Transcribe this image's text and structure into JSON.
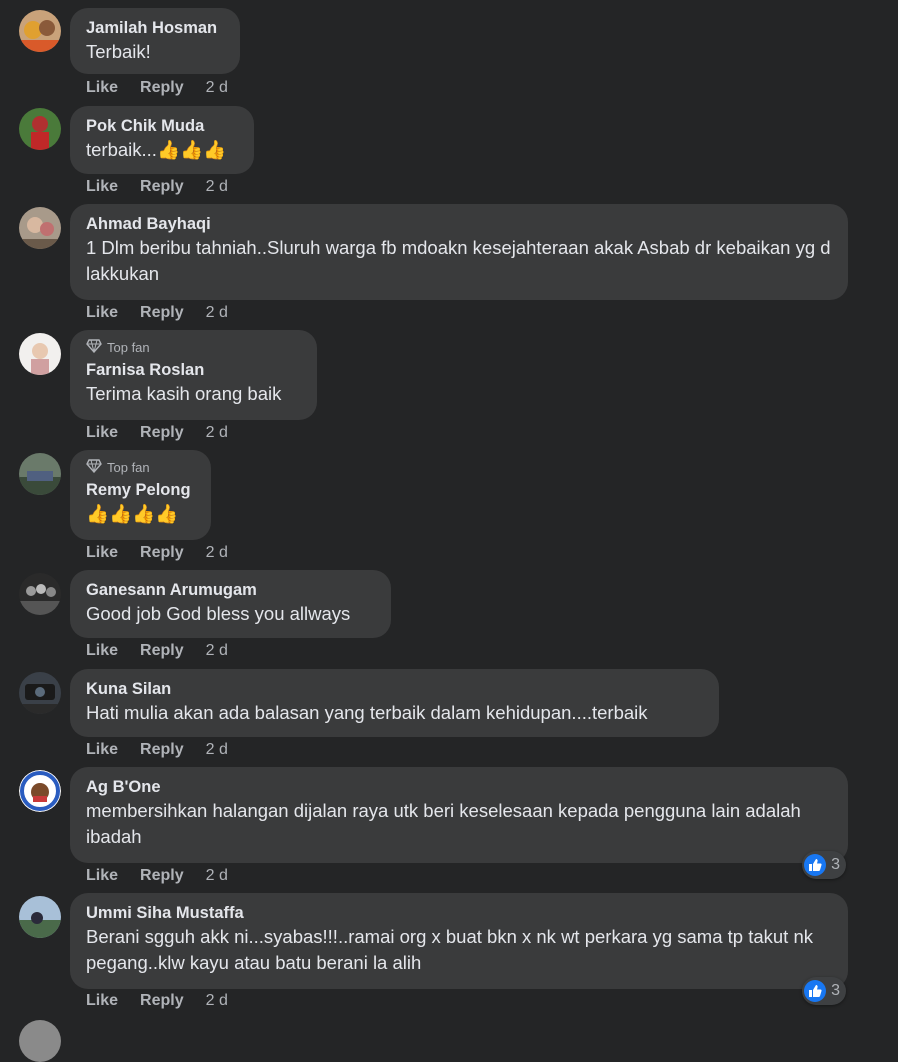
{
  "labels": {
    "like": "Like",
    "reply": "Reply"
  },
  "colors": {
    "background": "#242526",
    "bubble": "#3a3b3c",
    "text": "#e4e6eb",
    "secondary": "#b0b3b8",
    "like_blue": "#1877f2"
  },
  "comments": [
    {
      "author": "Jamilah Hosman",
      "text": "Terbaik!",
      "time": "2 d",
      "avatar": "avatar-jamilah"
    },
    {
      "author": "Pok Chik Muda",
      "text": "terbaik...👍👍👍",
      "time": "2 d",
      "avatar": "avatar-pokchik"
    },
    {
      "author": "Ahmad Bayhaqi",
      "text": "1 Dlm beribu tahniah..Sluruh warga fb mdoakn kesejahteraan akak Asbab dr kebaikan yg d lakkukan",
      "time": "2 d",
      "avatar": "avatar-ahmad"
    },
    {
      "author": "Farnisa Roslan",
      "badge": "Top fan",
      "text": "Terima kasih orang baik",
      "time": "2 d",
      "avatar": "avatar-farnisa"
    },
    {
      "author": "Remy Pelong",
      "badge": "Top fan",
      "text": "👍👍👍👍",
      "time": "2 d",
      "avatar": "avatar-remy"
    },
    {
      "author": "Ganesann Arumugam",
      "text": "Good job God bless you allways",
      "time": "2 d",
      "avatar": "avatar-ganesann"
    },
    {
      "author": "Kuna Silan",
      "text": "Hati mulia akan ada balasan yang terbaik dalam kehidupan....terbaik",
      "time": "2 d",
      "avatar": "avatar-kuna"
    },
    {
      "author": "Ag B'One",
      "text": "membersihkan halangan dijalan raya utk beri keselesaan kepada pengguna lain adalah ibadah",
      "time": "2 d",
      "reactions": "3",
      "reaction_icon": "like-icon",
      "avatar": "avatar-agbone"
    },
    {
      "author": "Ummi Siha Mustaffa",
      "text": "Berani sgguh akk ni...syabas!!!..ramai org x buat bkn x nk wt perkara yg sama tp takut nk pegang..klw kayu atau batu berani la alih",
      "time": "2 d",
      "reactions": "3",
      "reaction_icon": "like-icon",
      "avatar": "avatar-ummi"
    }
  ]
}
